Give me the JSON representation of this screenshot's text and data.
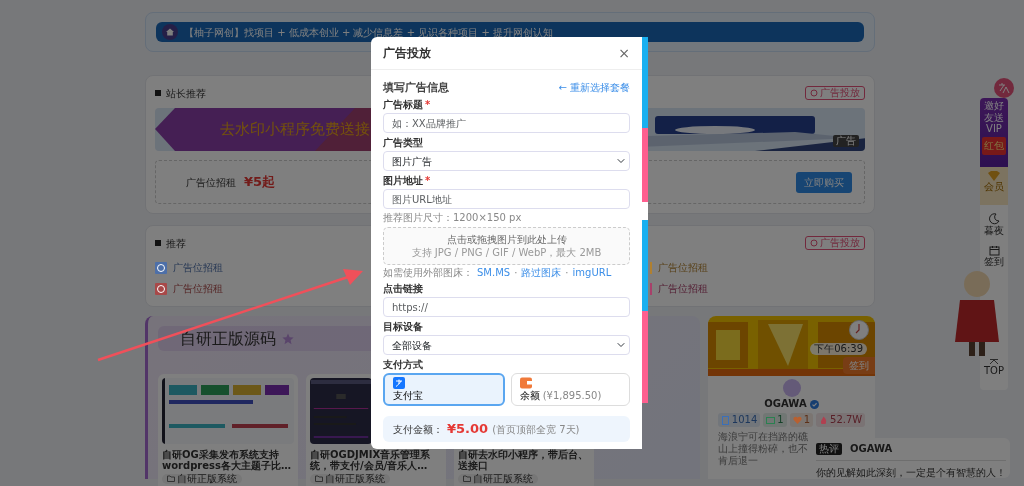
{
  "background": {
    "banner": {
      "text": "【柚子网创】找项目 + 低成本创业 + 减少信息差 + 见识各种项目 + 提升网创认知"
    },
    "featured": {
      "title": "站长推荐",
      "badge": "广告投放",
      "ad_text": "去水印小程序免费送接",
      "ad_tag": "广告",
      "slot_label": "广告位招租",
      "price": "¥5起",
      "buy_button": "立即购买"
    },
    "recommend": {
      "title": "推荐",
      "badge": "广告投放",
      "links": [
        {
          "text": "广告位招租",
          "kind": "icon",
          "color": "#4d6fa8"
        },
        {
          "text": "广告位招租",
          "kind": "bar",
          "color": "#b08030"
        },
        {
          "text": "广告位招租",
          "kind": "icon",
          "color": "#a84848"
        },
        {
          "text": "广告位招租",
          "kind": "bar",
          "color": "#a8406a"
        }
      ]
    },
    "source_section": {
      "title": "自研正版源码",
      "products": [
        {
          "title": "自研OG采集发布系统支持wordpress各大主题子比…",
          "tag": "自研正版系统",
          "kind": "light"
        },
        {
          "title": "自研OGDJMIX音乐管理系统，带支付/会员/音乐人…",
          "tag": "自研正版系统",
          "kind": "dark"
        },
        {
          "title": "自研去水印小程序，带后台、送接口",
          "tag": "自研正版系统",
          "kind": "covered"
        }
      ]
    },
    "profile": {
      "time": "下午06:39",
      "checkin": "签到",
      "name": "OGAWA",
      "stats": [
        {
          "kind": "posts",
          "text": "1014",
          "color": "#3b6fb8"
        },
        {
          "kind": "comments",
          "text": "1",
          "color": "#2a8050"
        },
        {
          "kind": "likes",
          "text": "1",
          "color": "#b86030"
        },
        {
          "kind": "views",
          "text": "52.7W",
          "color": "#b04050"
        }
      ],
      "motto": "海浪宁可在挡路的礁山上撞得粉碎，也不肯后退一"
    },
    "comment": {
      "badge": "热评",
      "user": "OGAWA",
      "text": "你的见解如此深刻，一定是个有智慧的人！"
    },
    "float_bar": {
      "invite": "邀好友送VIP",
      "red_packet": "红包",
      "vip": "会员",
      "night": "暮夜",
      "checkin": "签到",
      "top": "TOP"
    }
  },
  "modal": {
    "title": "广告投放",
    "close": "×",
    "section_title": "填写广告信息",
    "back_link": "← 重新选择套餐",
    "fields": [
      {
        "kind": "input",
        "label": "广告标题",
        "required_mark": "*",
        "placeholder": "如：XX品牌推广"
      },
      {
        "kind": "select",
        "label": "广告类型",
        "value": "图片广告"
      },
      {
        "kind": "input",
        "label": "图片地址",
        "required_mark": "*",
        "placeholder": "图片URL地址"
      },
      {
        "kind": "hint",
        "text": "推荐图片尺寸：1200×150 px"
      },
      {
        "kind": "upload",
        "title": "点击或拖拽图片到此处上传",
        "subtitle": "支持 JPG / PNG / GIF / WebP，最大 2MB"
      },
      {
        "kind": "links",
        "parts": [
          {
            "kind": "text",
            "text": "如需使用外部图床："
          },
          {
            "kind": "link",
            "text": "SM.MS"
          },
          {
            "kind": "text",
            "text": "·"
          },
          {
            "kind": "link",
            "text": "路过图床"
          },
          {
            "kind": "text",
            "text": "·"
          },
          {
            "kind": "link",
            "text": "imgURL"
          }
        ]
      },
      {
        "kind": "input",
        "label": "点击链接",
        "placeholder": "https://"
      },
      {
        "kind": "select",
        "label": "目标设备",
        "value": "全部设备"
      }
    ],
    "payment": {
      "label": "支付方式",
      "options": [
        {
          "kind": "alipay",
          "label": "支付宝",
          "selected": true
        },
        {
          "kind": "balance",
          "label": "余额",
          "detail": "(¥1,895.50)",
          "selected": false
        }
      ]
    },
    "amount": {
      "label": "支付金额：",
      "value": "¥5.00",
      "note": "(首页顶部全宽 7天)"
    }
  }
}
